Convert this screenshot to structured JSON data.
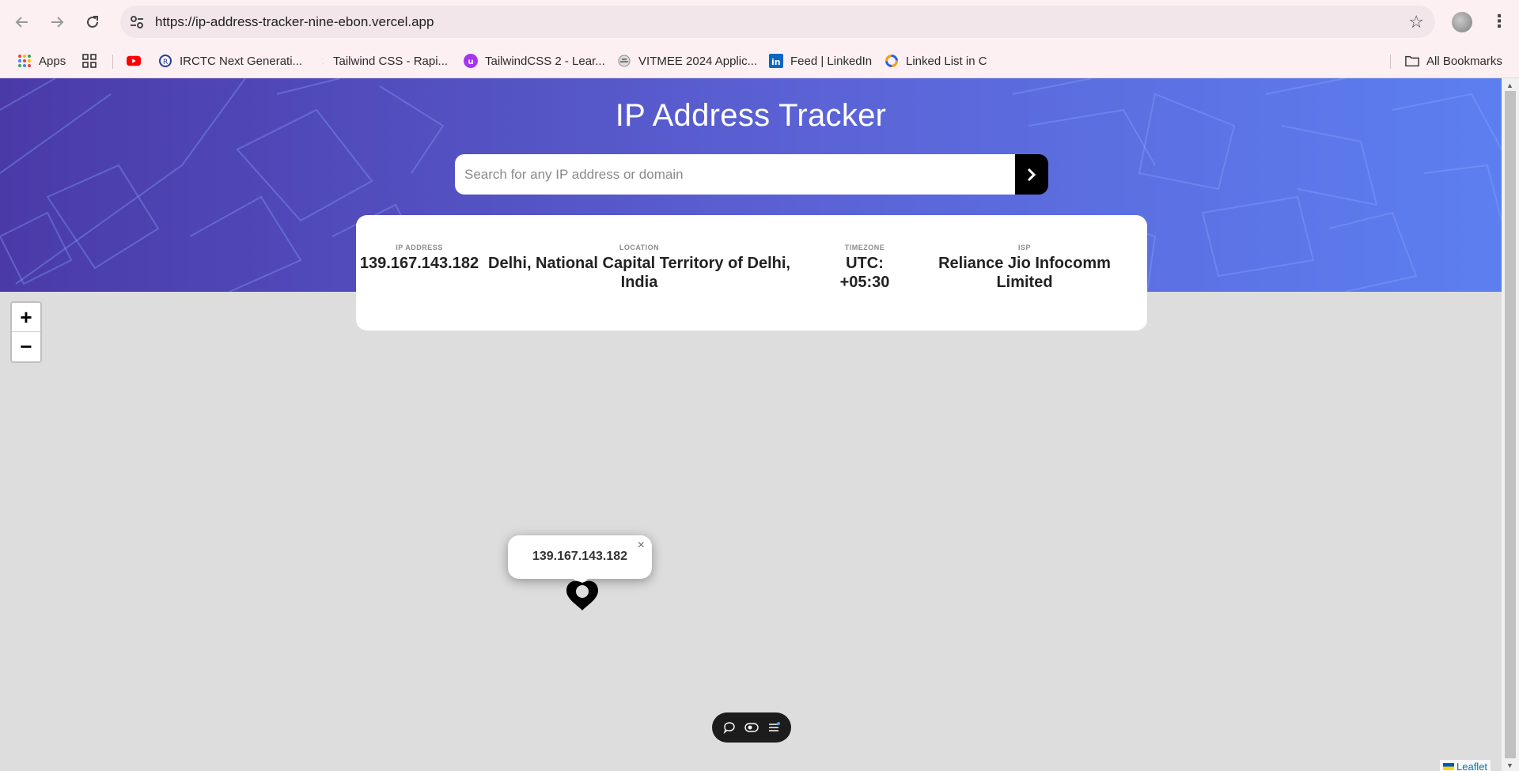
{
  "browser": {
    "url": "https://ip-address-tracker-nine-ebon.vercel.app",
    "bookmarks": [
      {
        "label": "Apps",
        "icon": "apps-grid-icon"
      },
      {
        "label": "",
        "icon": "grid-icon"
      },
      {
        "label": "",
        "icon": "youtube-icon"
      },
      {
        "label": "IRCTC Next Generati...",
        "icon": "irctc-icon"
      },
      {
        "label": "Tailwind CSS - Rapi...",
        "icon": "tailwind-icon"
      },
      {
        "label": "TailwindCSS 2 - Lear...",
        "icon": "udemy-icon"
      },
      {
        "label": "VITMEE 2024 Applic...",
        "icon": "vit-icon"
      },
      {
        "label": "Feed | LinkedIn",
        "icon": "linkedin-icon"
      },
      {
        "label": "Linked List in C",
        "icon": "circle-logo-icon"
      }
    ],
    "all_bookmarks_label": "All Bookmarks"
  },
  "header": {
    "title": "IP Address Tracker",
    "search_placeholder": "Search for any IP address or domain"
  },
  "info": {
    "ip_label": "IP ADDRESS",
    "ip_value": "139.167.143.182",
    "location_label": "LOCATION",
    "location_line1": "Delhi, National Capital Territory of Delhi,",
    "location_line2": "India",
    "timezone_label": "TIMEZONE",
    "timezone_line1": "UTC:",
    "timezone_line2": "+05:30",
    "isp_label": "ISP",
    "isp_line1": "Reliance Jio Infocomm",
    "isp_line2": "Limited"
  },
  "map": {
    "zoom_in": "+",
    "zoom_out": "−",
    "popup_text": "139.167.143.182",
    "popup_close": "×",
    "attribution": "Leaflet"
  },
  "colors": {
    "hero_start": "#4a3aa8",
    "hero_end": "#5c7ff0",
    "map_bg": "#dddddd"
  }
}
